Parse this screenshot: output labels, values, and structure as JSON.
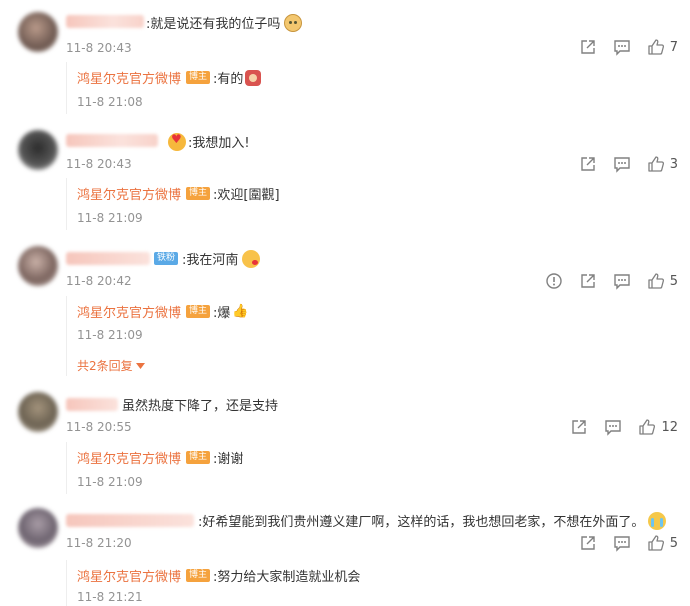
{
  "accent_color": "#eb7340",
  "badge_color": "#f5a23d",
  "icons": {
    "share": "share-icon",
    "comment": "comment-icon",
    "like": "thumbs-up-icon",
    "report": "report-icon"
  },
  "comments": [
    {
      "text": ":就是说还有我的位子吗",
      "emoji": "doge-emoji",
      "time": "11-8 20:43",
      "likes": "7",
      "reply": {
        "author": "鸿星尔克官方微博",
        "badge": "博主",
        "text": ":有的",
        "emoji": "red-envelope-emoji",
        "time": "11-8 21:08"
      }
    },
    {
      "text": ":我想加入!",
      "emoji": "heart-eyes-emoji",
      "time": "11-8 20:43",
      "likes": "3",
      "reply": {
        "author": "鸿星尔克官方微博",
        "badge": "博主",
        "text": ":欢迎[圍觀]",
        "time": "11-8 21:09"
      }
    },
    {
      "fan_tag": "铁粉",
      "text": ":我在河南",
      "emoji": "kiss-emoji",
      "time": "11-8 20:42",
      "likes": "5",
      "reply": {
        "author": "鸿星尔克官方微博",
        "badge": "博主",
        "text": ":爆",
        "emoji": "thumbs-emoji",
        "time": "11-8 21:09"
      },
      "more_replies": "共2条回复"
    },
    {
      "text": "虽然热度下降了，还是支持",
      "time": "11-8 20:55",
      "likes": "12",
      "reply": {
        "author": "鸿星尔克官方微博",
        "badge": "博主",
        "text": ":谢谢",
        "time": "11-8 21:09"
      }
    },
    {
      "text": ":好希望能到我们贵州遵义建厂啊，这样的话，我也想回老家，不想在外面了。",
      "emoji": "crying-emoji",
      "time": "11-8 21:20",
      "likes": "5",
      "reply": {
        "author": "鸿星尔克官方微博",
        "badge": "博主",
        "text": ":努力给大家制造就业机会",
        "time": "11-8 21:21"
      }
    }
  ]
}
